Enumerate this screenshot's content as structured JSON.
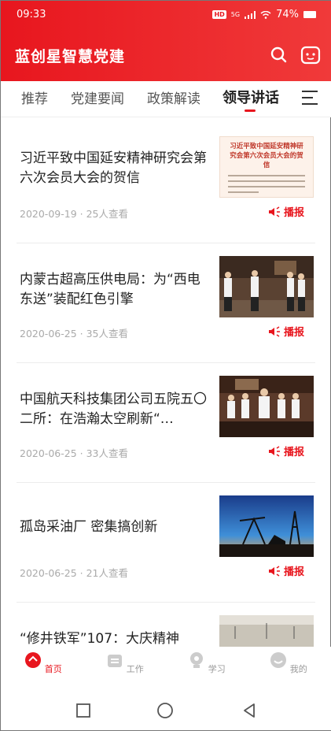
{
  "status": {
    "time": "09:33",
    "badge": "HD",
    "network": "5G",
    "battery": "74%"
  },
  "app": {
    "title": "蓝创星智慧党建"
  },
  "tabs": [
    {
      "label": "推荐"
    },
    {
      "label": "党建要闻"
    },
    {
      "label": "政策解读"
    },
    {
      "label": "领导讲话"
    }
  ],
  "news": [
    {
      "title": "习近平致中国延安精神研究会第六次会员大会的贺信",
      "date": "2020-09-19",
      "views": "25人查看",
      "play": "播报",
      "thumb_title": "习近平致中国延安精神研究会第六次会员大会的贺信"
    },
    {
      "title": "内蒙古超高压供电局：为“西电东送”装配红色引擎",
      "date": "2020-06-25",
      "views": "35人查看",
      "play": "播报"
    },
    {
      "title": "中国航天科技集团公司五院五〇二所：在浩瀚太空刷新“…",
      "date": "2020-06-25",
      "views": "33人查看",
      "play": "播报"
    },
    {
      "title": "孤岛采油厂 密集搞创新",
      "date": "2020-06-25",
      "views": "21人查看",
      "play": "播报"
    },
    {
      "title": "“修井铁军”107：大庆精神"
    }
  ],
  "bottom_nav": [
    {
      "label": "首页"
    },
    {
      "label": "工作"
    },
    {
      "label": "学习"
    },
    {
      "label": "我的"
    }
  ],
  "colors": {
    "accent": "#e8161e"
  }
}
